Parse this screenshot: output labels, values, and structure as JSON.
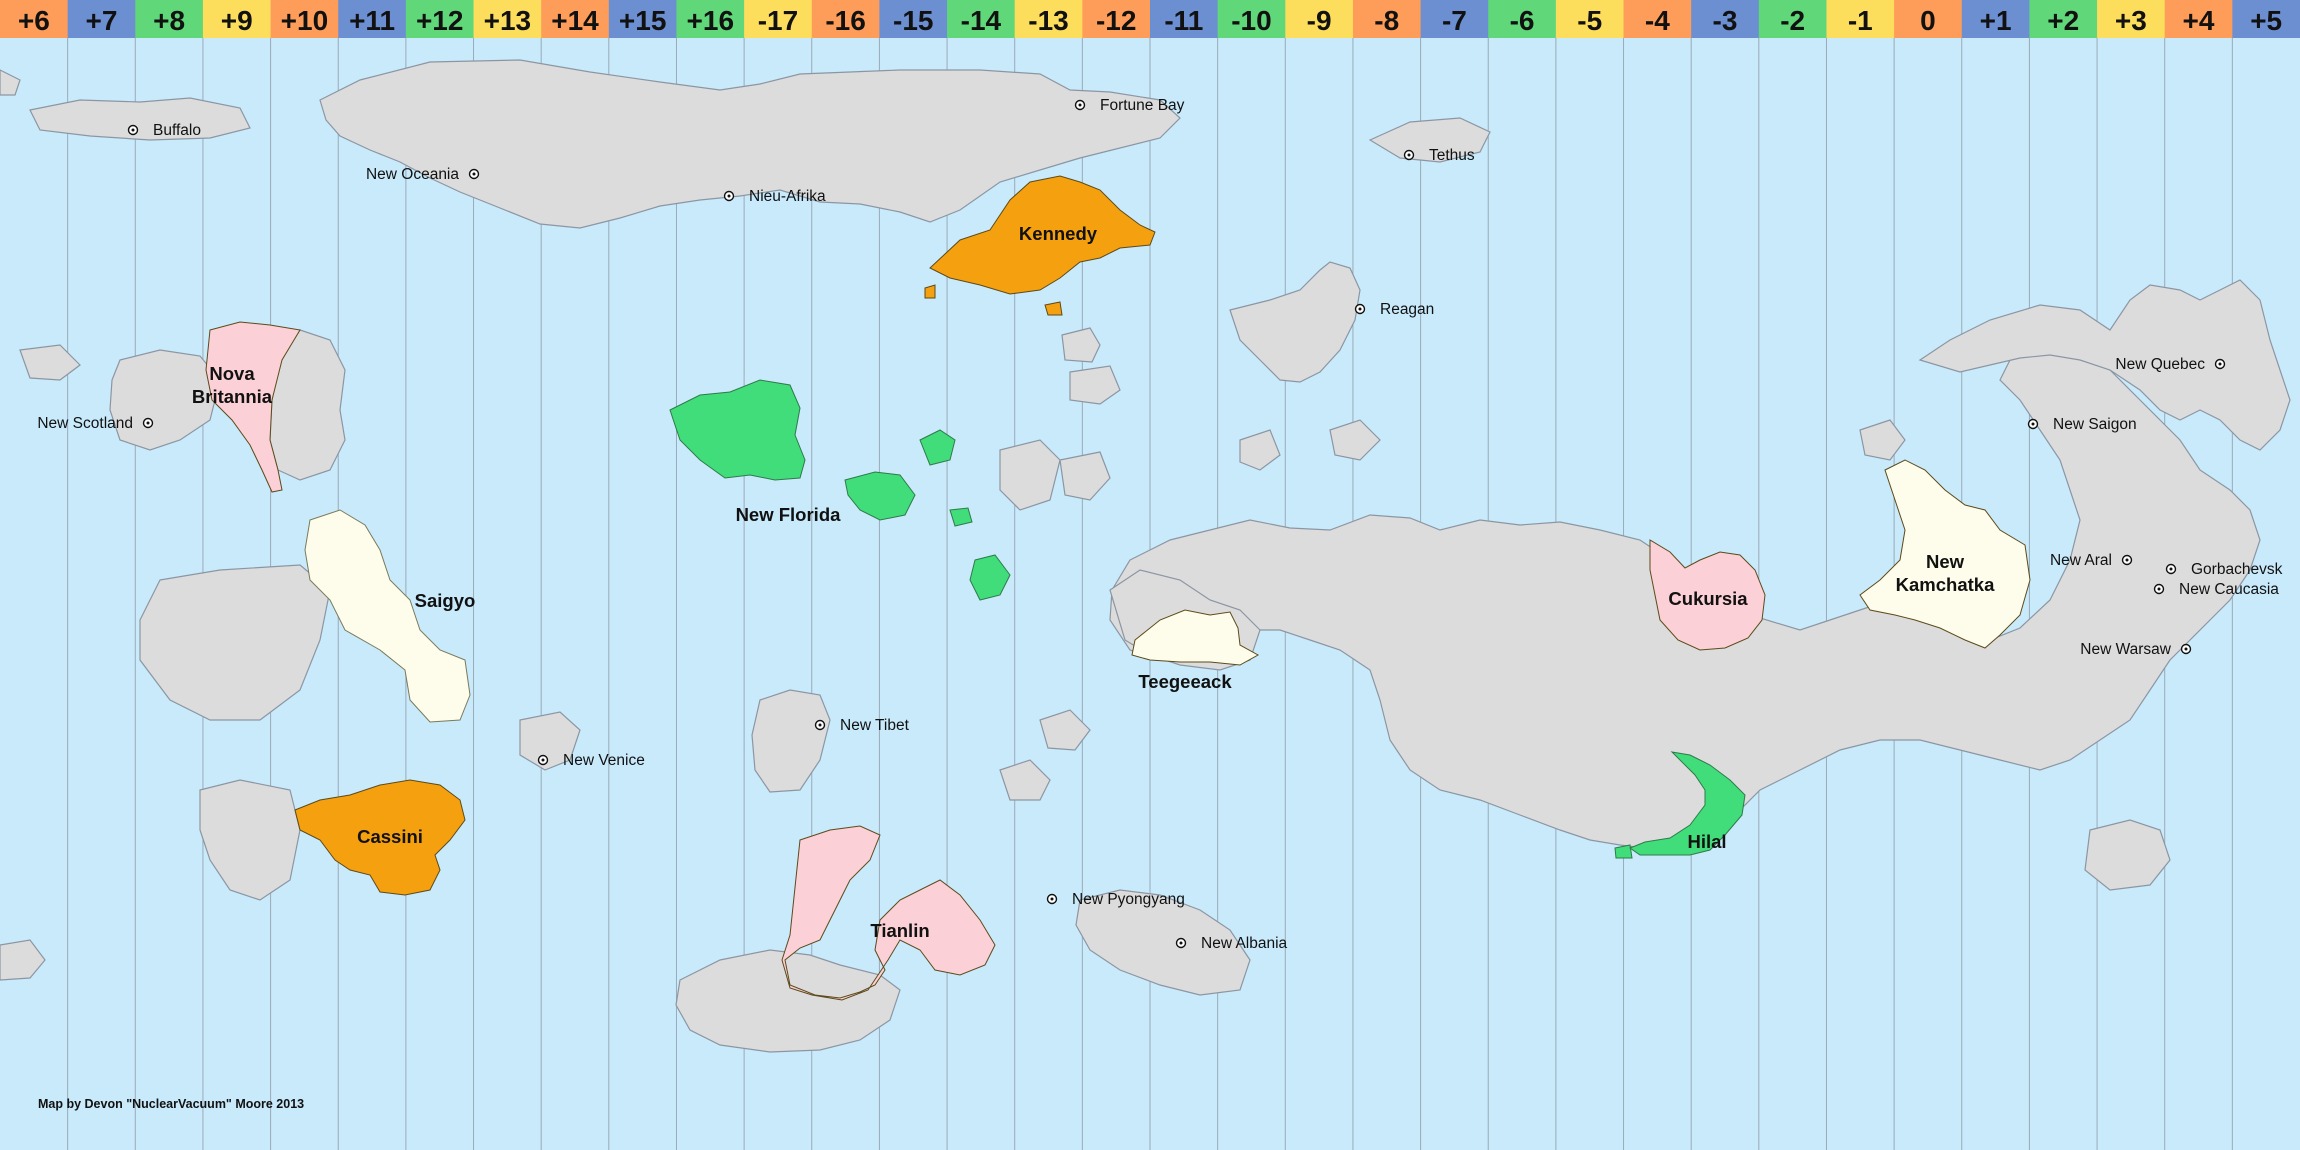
{
  "map": {
    "credit": "Map by Devon \"NuclearVacuum\" Moore 2013",
    "colors": {
      "ocean": "#c8eafb",
      "land": "#dcdcdc",
      "coast": "#8c96a3",
      "orange": "#f5a00f",
      "green": "#40dd7a",
      "pink": "#fbd0d6",
      "cream": "#fefcea",
      "tz_orange": "#fd9d59",
      "tz_blue": "#6c8fd2",
      "tz_green": "#60d87a",
      "tz_yellow": "#fddd5c"
    },
    "timezones": [
      {
        "label": "+6",
        "color": "tz_orange"
      },
      {
        "label": "+7",
        "color": "tz_blue"
      },
      {
        "label": "+8",
        "color": "tz_green"
      },
      {
        "label": "+9",
        "color": "tz_yellow"
      },
      {
        "label": "+10",
        "color": "tz_orange"
      },
      {
        "label": "+11",
        "color": "tz_blue"
      },
      {
        "label": "+12",
        "color": "tz_green"
      },
      {
        "label": "+13",
        "color": "tz_yellow"
      },
      {
        "label": "+14",
        "color": "tz_orange"
      },
      {
        "label": "+15",
        "color": "tz_blue"
      },
      {
        "label": "+16",
        "color": "tz_green"
      },
      {
        "label": "-17",
        "color": "tz_yellow"
      },
      {
        "label": "-16",
        "color": "tz_orange"
      },
      {
        "label": "-15",
        "color": "tz_blue"
      },
      {
        "label": "-14",
        "color": "tz_green"
      },
      {
        "label": "-13",
        "color": "tz_yellow"
      },
      {
        "label": "-12",
        "color": "tz_orange"
      },
      {
        "label": "-11",
        "color": "tz_blue"
      },
      {
        "label": "-10",
        "color": "tz_green"
      },
      {
        "label": "-9",
        "color": "tz_yellow"
      },
      {
        "label": "-8",
        "color": "tz_orange"
      },
      {
        "label": "-7",
        "color": "tz_blue"
      },
      {
        "label": "-6",
        "color": "tz_green"
      },
      {
        "label": "-5",
        "color": "tz_yellow"
      },
      {
        "label": "-4",
        "color": "tz_orange"
      },
      {
        "label": "-3",
        "color": "tz_blue"
      },
      {
        "label": "-2",
        "color": "tz_green"
      },
      {
        "label": "-1",
        "color": "tz_yellow"
      },
      {
        "label": "0",
        "color": "tz_orange"
      },
      {
        "label": "+1",
        "color": "tz_blue"
      },
      {
        "label": "+2",
        "color": "tz_green"
      },
      {
        "label": "+3",
        "color": "tz_yellow"
      },
      {
        "label": "+4",
        "color": "tz_orange"
      },
      {
        "label": "+5",
        "color": "tz_blue"
      }
    ],
    "cities": [
      "Buffalo",
      "New Oceania",
      "Nieu-Afrika",
      "Fortune Bay",
      "Tethus",
      "Reagan",
      "New Scotland",
      "New Venice",
      "New Tibet",
      "New Pyongyang",
      "New Albania",
      "New Quebec",
      "New Saigon",
      "New Aral",
      "Gorbachevsk",
      "New Caucasia",
      "New Warsaw"
    ],
    "regions": [
      {
        "name": "Kennedy",
        "color": "orange"
      },
      {
        "name": "Nova Britannia",
        "lines": [
          "Nova",
          "Britannia"
        ],
        "color": "pink"
      },
      {
        "name": "New Florida",
        "color": "green"
      },
      {
        "name": "Saigyo",
        "color": "cream"
      },
      {
        "name": "Cassini",
        "color": "orange"
      },
      {
        "name": "Tianlin",
        "color": "pink"
      },
      {
        "name": "Teegeeack",
        "color": "cream"
      },
      {
        "name": "Cukursia",
        "color": "pink"
      },
      {
        "name": "New Kamchatka",
        "lines": [
          "New",
          "Kamchatka"
        ],
        "color": "cream"
      },
      {
        "name": "Hilal",
        "color": "green"
      }
    ]
  }
}
